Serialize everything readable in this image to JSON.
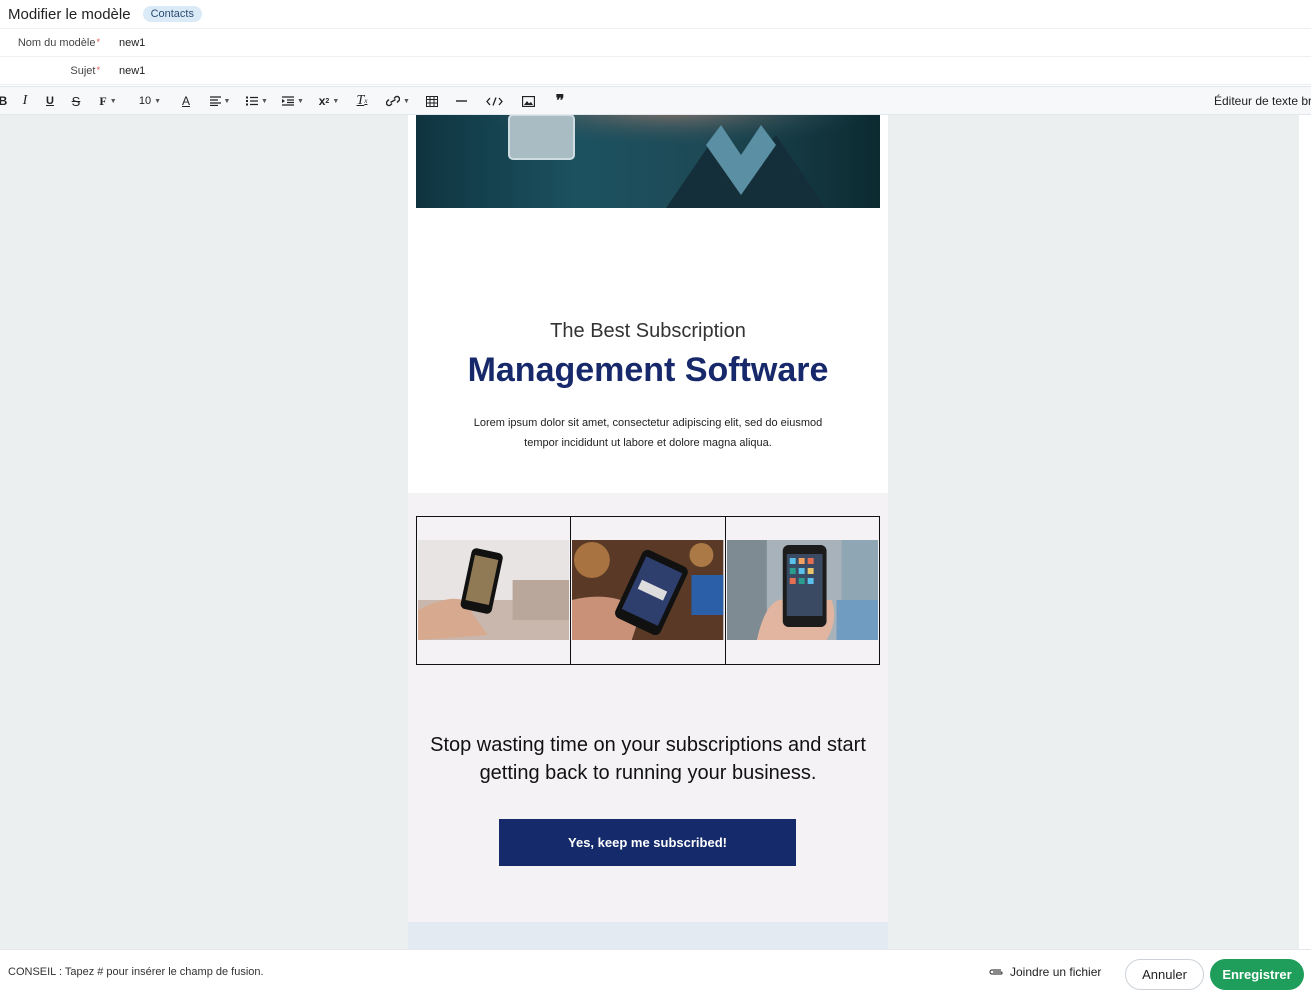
{
  "header": {
    "title": "Modifier le modèle",
    "badge": "Contacts"
  },
  "form": {
    "name_label": "Nom du modèle",
    "name_value": "new1",
    "subject_label": "Sujet",
    "subject_value": "new1",
    "required_mark": "*"
  },
  "toolbar": {
    "bold": "B",
    "italic": "I",
    "underline": "U",
    "strike": "S",
    "font": "F",
    "font_size": "10",
    "text_color": "A",
    "right_label": "Éditeur de texte br",
    "icons": [
      "bold-icon",
      "italic-icon",
      "underline-icon",
      "strikethrough-icon",
      "font-family-icon",
      "font-size-select",
      "text-color-icon",
      "align-icon",
      "ordered-list-icon",
      "indent-icon",
      "superscript-icon",
      "clear-format-icon",
      "link-icon",
      "table-icon",
      "horizontal-rule-icon",
      "code-view-icon",
      "image-icon",
      "quote-icon"
    ]
  },
  "email": {
    "subtitle": "The Best Subscription",
    "title": "Management Software",
    "lorem": "Lorem ipsum dolor sit amet, consectetur adipiscing elit, sed do eiusmod tempor incididunt ut labore et dolore magna aliqua.",
    "stop_text": "Stop wasting time on your subscriptions and start getting back to running your business.",
    "cta": "Yes, keep me subscribed!",
    "colors": {
      "title": "#17296b",
      "cta_bg": "#142a6b",
      "section_bg": "#f4f2f5"
    }
  },
  "footer": {
    "tip": "CONSEIL : Tapez # pour insérer le champ de fusion.",
    "attach": "Joindre un fichier",
    "cancel": "Annuler",
    "save": "Enregistrer",
    "save_color": "#1e9e5a"
  }
}
